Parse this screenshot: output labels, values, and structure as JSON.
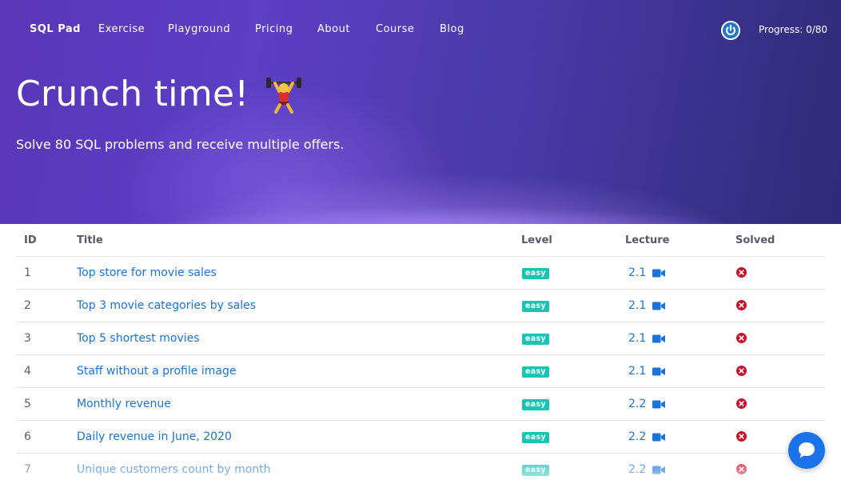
{
  "nav": {
    "brand": "SQL Pad",
    "links": [
      "Exercise",
      "Playground",
      "Pricing",
      "About",
      "Course",
      "Blog"
    ],
    "progress": "Progress: 0/80"
  },
  "hero": {
    "title": "Crunch time!",
    "title_emoji": "weight-lifter-icon",
    "subtitle": "Solve 80 SQL problems and receive multiple offers."
  },
  "table": {
    "headers": {
      "id": "ID",
      "title": "Title",
      "level": "Level",
      "lecture": "Lecture",
      "solved": "Solved"
    },
    "rows": [
      {
        "id": "1",
        "title": "Top store for movie sales",
        "level": "easy",
        "lecture": "2.1",
        "solved": false
      },
      {
        "id": "2",
        "title": "Top 3 movie categories by sales",
        "level": "easy",
        "lecture": "2.1",
        "solved": false
      },
      {
        "id": "3",
        "title": "Top 5 shortest movies",
        "level": "easy",
        "lecture": "2.1",
        "solved": false
      },
      {
        "id": "4",
        "title": "Staff without a profile image",
        "level": "easy",
        "lecture": "2.1",
        "solved": false
      },
      {
        "id": "5",
        "title": "Monthly revenue",
        "level": "easy",
        "lecture": "2.2",
        "solved": false
      },
      {
        "id": "6",
        "title": "Daily revenue in June, 2020",
        "level": "easy",
        "lecture": "2.2",
        "solved": false
      },
      {
        "id": "7",
        "title": "Unique customers count by month",
        "level": "easy",
        "lecture": "2.2",
        "solved": false
      }
    ]
  },
  "colors": {
    "link": "#1a73d9",
    "badge": "#19c4b2",
    "unsolved": "#c8102e",
    "chat": "#1a73e8"
  }
}
